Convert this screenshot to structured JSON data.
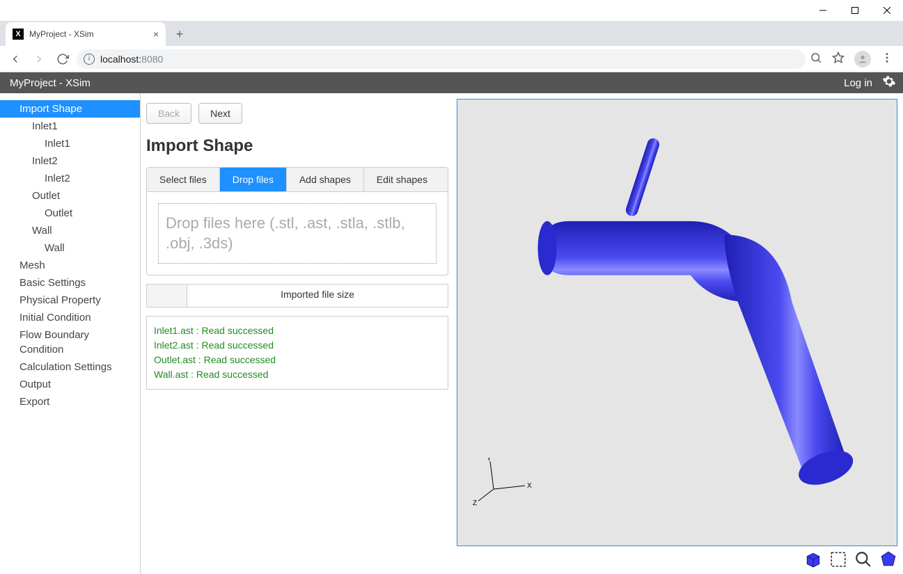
{
  "os": {
    "title": ""
  },
  "browser": {
    "tab_title": "MyProject - XSim",
    "url_host": "localhost:",
    "url_port": "8080"
  },
  "app_header": {
    "title": "MyProject - XSim",
    "login": "Log in"
  },
  "sidebar": {
    "items": [
      {
        "label": "Import Shape",
        "level": 1,
        "selected": true
      },
      {
        "label": "Inlet1",
        "level": 2
      },
      {
        "label": "Inlet1",
        "level": 3
      },
      {
        "label": "Inlet2",
        "level": 2
      },
      {
        "label": "Inlet2",
        "level": 3
      },
      {
        "label": "Outlet",
        "level": 2
      },
      {
        "label": "Outlet",
        "level": 3
      },
      {
        "label": "Wall",
        "level": 2
      },
      {
        "label": "Wall",
        "level": 3
      },
      {
        "label": "Mesh",
        "level": 1
      },
      {
        "label": "Basic Settings",
        "level": 1
      },
      {
        "label": "Physical Property",
        "level": 1
      },
      {
        "label": "Initial Condition",
        "level": 1
      },
      {
        "label": "Flow Boundary Condition",
        "level": 1
      },
      {
        "label": "Calculation Settings",
        "level": 1
      },
      {
        "label": "Output",
        "level": 1
      },
      {
        "label": "Export",
        "level": 1
      }
    ]
  },
  "form": {
    "back": "Back",
    "next": "Next",
    "title": "Import Shape",
    "tabs": {
      "select_files": "Select files",
      "drop_files": "Drop files",
      "add_shapes": "Add shapes",
      "edit_shapes": "Edit shapes"
    },
    "drop_text": "Drop files here (.stl, .ast, .stla, .stlb, .obj, .3ds)",
    "table_header": "Imported file size",
    "log": [
      "Inlet1.ast : Read successed",
      "Inlet2.ast : Read successed",
      "Outlet.ast : Read successed",
      "Wall.ast : Read successed"
    ]
  },
  "viewer": {
    "axes": {
      "x": "X",
      "y": "Y",
      "z": "Z"
    }
  }
}
